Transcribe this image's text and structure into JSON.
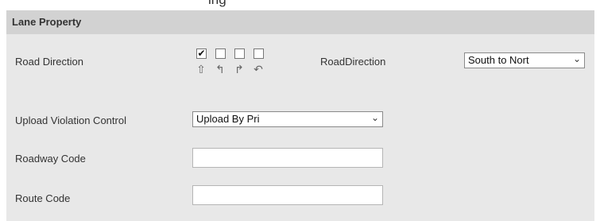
{
  "top_strip_text": "ing",
  "panel": {
    "title": "Lane Property"
  },
  "road_direction": {
    "label": "Road Direction",
    "checkboxes": [
      {
        "checked": true,
        "icon": "arrow-straight-icon",
        "glyph": "⇧"
      },
      {
        "checked": false,
        "icon": "arrow-left-turn-icon",
        "glyph": "↰"
      },
      {
        "checked": false,
        "icon": "arrow-right-turn-icon",
        "glyph": "↱"
      },
      {
        "checked": false,
        "icon": "arrow-u-turn-icon",
        "glyph": "↶"
      }
    ],
    "checked_glyph": "✔",
    "direction_label": "RoadDirection",
    "direction_value": "South to Nort"
  },
  "upload_violation": {
    "label": "Upload Violation Control",
    "value": "Upload By Pri"
  },
  "roadway_code": {
    "label": "Roadway Code",
    "value": ""
  },
  "route_code": {
    "label": "Route Code",
    "value": ""
  },
  "chevron_glyph": "⌄"
}
